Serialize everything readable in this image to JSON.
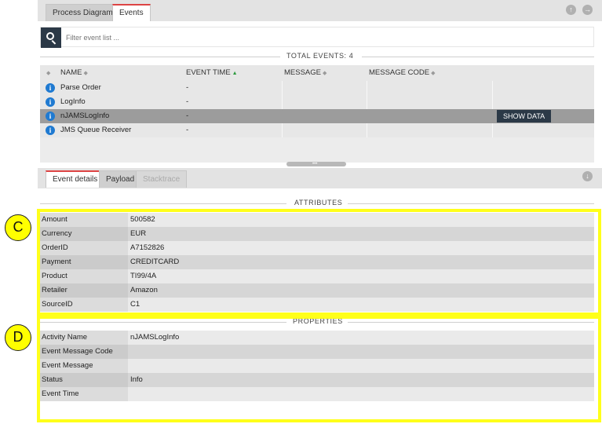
{
  "top_tabs": [
    {
      "label": "Process Diagram",
      "active": false
    },
    {
      "label": "Events",
      "active": true
    }
  ],
  "filter": {
    "placeholder": "Filter event list ..."
  },
  "total_events_label": "TOTAL EVENTS: 4",
  "events_table": {
    "columns": [
      "NAME",
      "EVENT TIME",
      "MESSAGE",
      "MESSAGE CODE"
    ],
    "rows": [
      {
        "name": "Parse Order",
        "time": "-"
      },
      {
        "name": "LogInfo",
        "time": "-"
      },
      {
        "name": "nJAMSLogInfo",
        "time": "-",
        "action": "SHOW DATA"
      },
      {
        "name": "JMS Queue Receiver",
        "time": "-"
      }
    ]
  },
  "detail_tabs": [
    {
      "label": "Event details",
      "state": "active"
    },
    {
      "label": "Payload",
      "state": "normal"
    },
    {
      "label": "Stacktrace",
      "state": "disabled"
    }
  ],
  "attributes": {
    "title": "ATTRIBUTES",
    "rows": [
      {
        "key": "Amount",
        "value": "500582"
      },
      {
        "key": "Currency",
        "value": "EUR"
      },
      {
        "key": "OrderID",
        "value": "A7152826"
      },
      {
        "key": "Payment",
        "value": "CREDITCARD"
      },
      {
        "key": "Product",
        "value": "TI99/4A"
      },
      {
        "key": "Retailer",
        "value": "Amazon"
      },
      {
        "key": "SourceID",
        "value": "C1"
      }
    ]
  },
  "properties": {
    "title": "PROPERTIES",
    "rows": [
      {
        "key": "Activity Name",
        "value": "nJAMSLogInfo"
      },
      {
        "key": "Event Message Code",
        "value": ""
      },
      {
        "key": "Event Message",
        "value": ""
      },
      {
        "key": "Status",
        "value": "Info"
      },
      {
        "key": "Event Time",
        "value": ""
      }
    ]
  },
  "annotations": {
    "c": "C",
    "d": "D"
  },
  "icons": {
    "up": "arrow-up-icon",
    "right": "arrow-right-icon",
    "down": "arrow-down-icon",
    "info": "info-icon",
    "search": "search-icon"
  },
  "colors": {
    "highlight": "#ffff1a",
    "dark_button": "#2b3947",
    "info_blue": "#1f7ad1",
    "active_tab_accent": "#d44444"
  }
}
